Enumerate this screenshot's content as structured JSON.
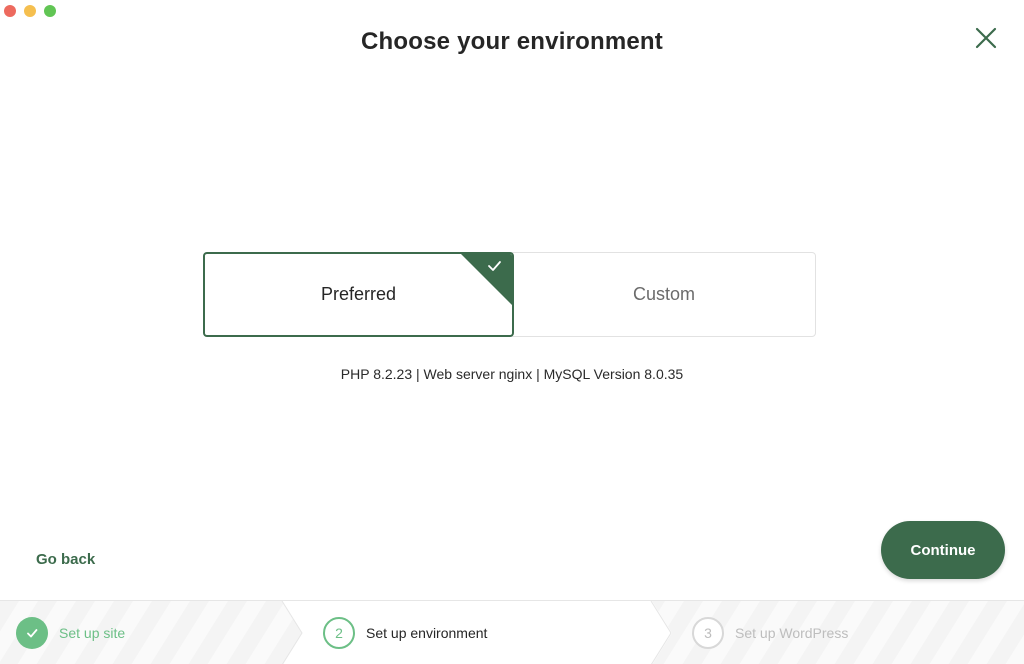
{
  "window": {
    "title": "Choose your environment"
  },
  "environment": {
    "options": [
      {
        "label": "Preferred",
        "selected": true
      },
      {
        "label": "Custom",
        "selected": false
      }
    ],
    "details": "PHP 8.2.23 | Web server nginx | MySQL Version 8.0.35"
  },
  "footer": {
    "back_label": "Go back",
    "continue_label": "Continue"
  },
  "steps": [
    {
      "number": "1",
      "label": "Set up site",
      "state": "done"
    },
    {
      "number": "2",
      "label": "Set up environment",
      "state": "current"
    },
    {
      "number": "3",
      "label": "Set up WordPress",
      "state": "upcoming"
    }
  ],
  "colors": {
    "brand_green": "#3c6b4c",
    "step_green": "#6cbf86",
    "muted_gray": "#bdbdbd"
  },
  "icons": {
    "close": "close-icon",
    "selected_check": "checkmark-icon",
    "step_done": "checkmark-icon"
  }
}
